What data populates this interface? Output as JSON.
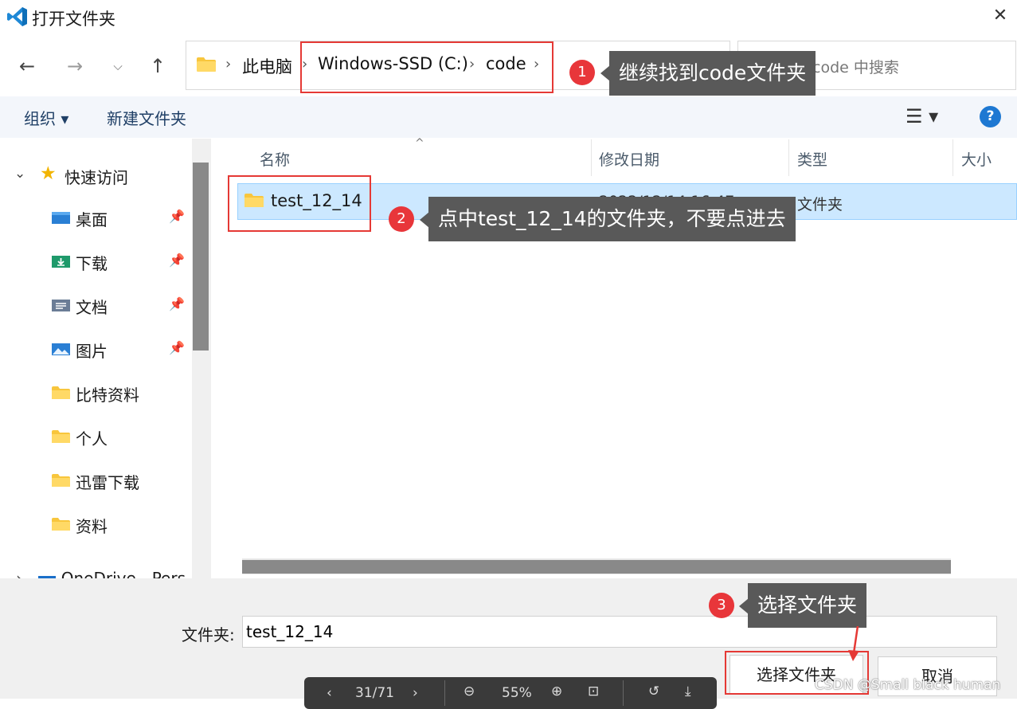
{
  "window": {
    "title": "打开文件夹",
    "close_glyph": "✕"
  },
  "nav_buttons": {
    "back": "←",
    "forward": "→",
    "recent": "⌵",
    "up": "↑"
  },
  "breadcrumb": {
    "sep": "›",
    "items": [
      "此电脑",
      "Windows-SSD (C:)",
      "code"
    ]
  },
  "search": {
    "placeholder": "在 code 中搜索"
  },
  "toolbar": {
    "organize": "组织 ▾",
    "new_folder": "新建文件夹",
    "view_glyph": "☰ ▾",
    "help": "?"
  },
  "sidebar": {
    "quick_access": "快速访问",
    "items": [
      {
        "label": "桌面",
        "pinned": true,
        "icon": "desktop-icon"
      },
      {
        "label": "下载",
        "pinned": true,
        "icon": "download-icon"
      },
      {
        "label": "文档",
        "pinned": true,
        "icon": "document-icon"
      },
      {
        "label": "图片",
        "pinned": true,
        "icon": "picture-icon"
      },
      {
        "label": "比特资料",
        "pinned": false,
        "icon": "folder-icon"
      },
      {
        "label": "个人",
        "pinned": false,
        "icon": "folder-icon"
      },
      {
        "label": "迅雷下载",
        "pinned": false,
        "icon": "folder-icon"
      },
      {
        "label": "资料",
        "pinned": false,
        "icon": "folder-icon"
      }
    ],
    "pin_glyph": "📌",
    "onedrive": "OneDrive - Pers"
  },
  "columns": {
    "name": "名称",
    "date": "修改日期",
    "type": "类型",
    "size": "大小"
  },
  "files": [
    {
      "name": "test_12_14",
      "date": "2022/12/14 16:47",
      "type": "文件夹",
      "selected": true
    }
  ],
  "footer": {
    "folder_label": "文件夹:",
    "folder_value": "test_12_14",
    "select_button": "选择文件夹",
    "cancel_button": "取消"
  },
  "annotations": [
    {
      "num": "1",
      "text": "继续找到code文件夹"
    },
    {
      "num": "2",
      "text": "点中test_12_14的文件夹，不要点进去"
    },
    {
      "num": "3",
      "text": "选择文件夹"
    }
  ],
  "viewer": {
    "page": "31/71",
    "zoom": "55%"
  },
  "watermark": "CSDN @Small black human",
  "colors": {
    "accent": "#1e78d2",
    "selection": "#cce8ff",
    "annotation_red": "#e53935",
    "callout_bg": "#595959",
    "folder_yellow": "#f8c63d"
  }
}
